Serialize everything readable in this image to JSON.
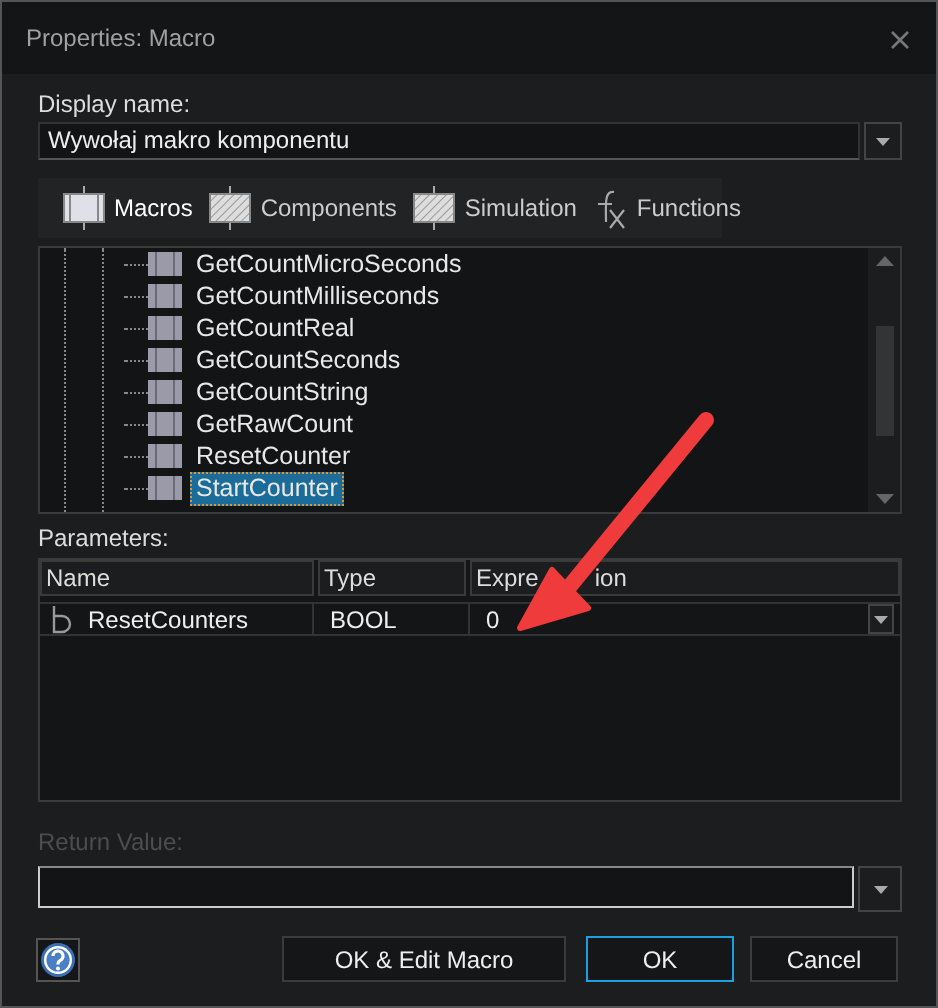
{
  "window": {
    "title": "Properties: Macro"
  },
  "display_name": {
    "label": "Display name:",
    "value": "Wywołaj makro komponentu"
  },
  "tabs": [
    {
      "label": "Macros",
      "kind": "macro",
      "selected": true
    },
    {
      "label": "Components",
      "kind": "hatched",
      "selected": false
    },
    {
      "label": "Simulation",
      "kind": "hatched",
      "selected": false
    },
    {
      "label": "Functions",
      "kind": "fx",
      "selected": false
    }
  ],
  "tree_items": [
    {
      "label": "GetCountMicroSeconds",
      "selected": false
    },
    {
      "label": "GetCountMilliseconds",
      "selected": false
    },
    {
      "label": "GetCountReal",
      "selected": false
    },
    {
      "label": "GetCountSeconds",
      "selected": false
    },
    {
      "label": "GetCountString",
      "selected": false
    },
    {
      "label": "GetRawCount",
      "selected": false
    },
    {
      "label": "ResetCounter",
      "selected": false
    },
    {
      "label": "StartCounter",
      "selected": true
    }
  ],
  "parameters": {
    "label": "Parameters:",
    "columns": [
      {
        "label": "Name"
      },
      {
        "label": "Type"
      },
      {
        "label": "Expre",
        "covered_tail": "ion"
      }
    ],
    "rows": [
      {
        "name": "ResetCounters",
        "type": "BOOL",
        "expression": "0"
      }
    ]
  },
  "return_value": {
    "label": "Return Value:",
    "disabled": true
  },
  "buttons": [
    {
      "label": "OK & Edit Macro",
      "default": false
    },
    {
      "label": "OK",
      "default": true
    },
    {
      "label": "Cancel",
      "default": false
    }
  ]
}
